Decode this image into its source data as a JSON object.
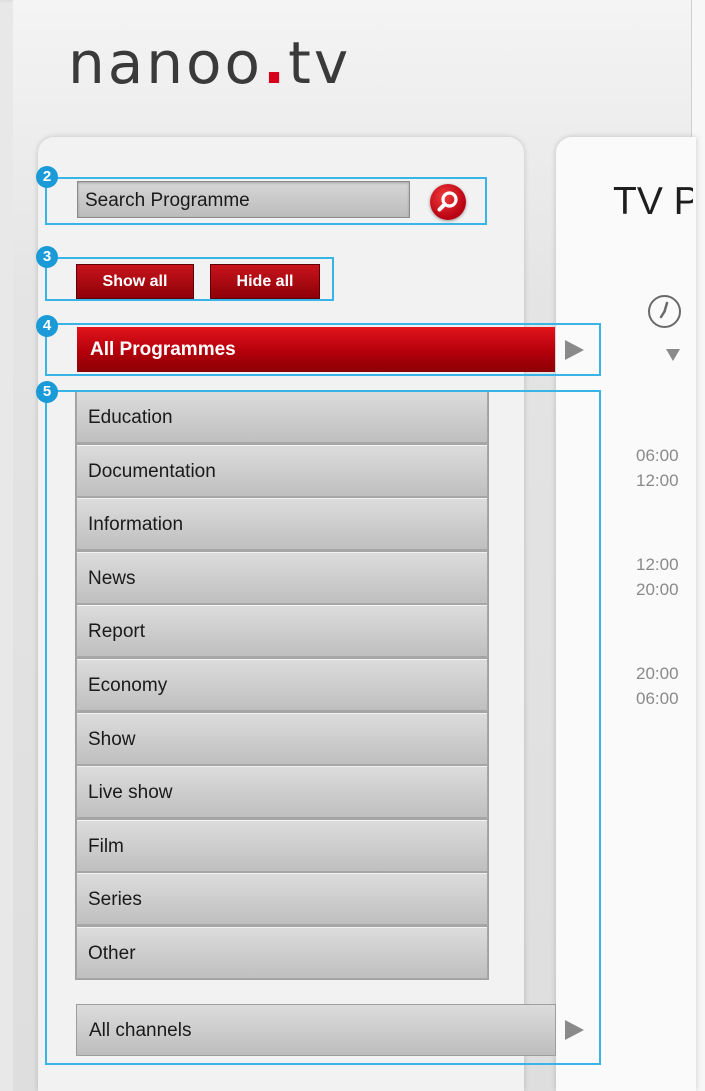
{
  "logo": {
    "part1": "nanoo",
    "dot": ".",
    "part2": "tv"
  },
  "annotations": {
    "search": "2",
    "toggle": "3",
    "all_programmes": "4",
    "categories": "5"
  },
  "search": {
    "placeholder": "Search Programme"
  },
  "toggle": {
    "show_all": "Show all",
    "hide_all": "Hide all"
  },
  "all_programmes": {
    "label": "All Programmes"
  },
  "categories": [
    "Education",
    "Documentation",
    "Information",
    "News",
    "Report",
    "Economy",
    "Show",
    "Live show",
    "Film",
    "Series",
    "Other"
  ],
  "channels": {
    "label": "All channels"
  },
  "main": {
    "title": "TV Programme",
    "time_slots": [
      {
        "start": "06:00",
        "end": "12:00"
      },
      {
        "start": "12:00",
        "end": "20:00"
      },
      {
        "start": "20:00",
        "end": "06:00"
      }
    ]
  },
  "colors": {
    "brand_red": "#d6001c",
    "annotation_blue": "#39b4e6"
  }
}
